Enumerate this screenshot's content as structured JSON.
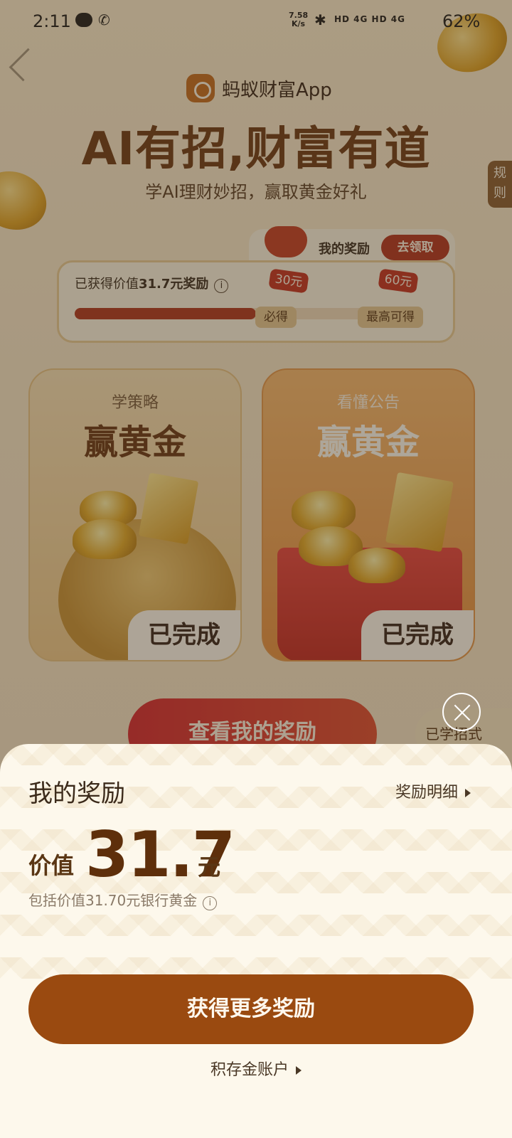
{
  "status_bar": {
    "time": "2:11",
    "net_speed": "7.58",
    "net_unit": "K/s",
    "signal_text": "HD 4G HD 4G",
    "battery": "62%"
  },
  "header": {
    "brand": "蚂蚁财富App",
    "headline": "AI有招,财富有道",
    "subheadline": "学AI理财妙招，赢取黄金好礼",
    "rules_tab": "规则"
  },
  "reward_card": {
    "my_reward_label": "我的奖励",
    "go_claim": "去领取",
    "earned_prefix": "已获得价值",
    "earned_value": "31.7元奖励",
    "progress_fraction": 0.58,
    "guaranteed_amount": "30元",
    "guaranteed_label": "必得",
    "max_amount": "60元",
    "max_label": "最高可得"
  },
  "tasks": [
    {
      "subtitle": "学策略",
      "title": "赢黄金",
      "status": "已完成"
    },
    {
      "subtitle": "看懂公告",
      "title": "赢黄金",
      "status": "已完成"
    }
  ],
  "bottom_actions": {
    "view_rewards": "查看我的奖励",
    "learned_moves": "已学招式"
  },
  "sheet": {
    "title": "我的奖励",
    "detail_link": "奖励明细",
    "value_prefix": "价值",
    "value_number": "31.7",
    "value_unit": "元",
    "includes_text": "包括价值31.70元银行黄金",
    "cta": "获得更多奖励",
    "account_link": "积存金账户"
  },
  "colors": {
    "accent": "#9a4a10",
    "sheet_bg": "#fdf8ec",
    "progress": "#b0341a"
  }
}
